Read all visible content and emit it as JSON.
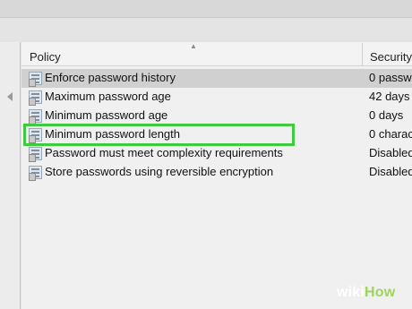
{
  "table": {
    "columns": {
      "policy": "Policy",
      "security": "Security"
    },
    "rows": [
      {
        "label": "Enforce password history",
        "value": "0 passw"
      },
      {
        "label": "Maximum password age",
        "value": "42 days"
      },
      {
        "label": "Minimum password age",
        "value": "0 days"
      },
      {
        "label": "Minimum password length",
        "value": "0 charac"
      },
      {
        "label": "Password must meet complexity requirements",
        "value": "Disabled"
      },
      {
        "label": "Store passwords using reversible encryption",
        "value": "Disabled"
      }
    ]
  },
  "watermark": {
    "wiki": "wiki",
    "how": "How"
  },
  "colors": {
    "highlight_box": "#3fca3f",
    "selected_row": "#d0d0d0"
  }
}
